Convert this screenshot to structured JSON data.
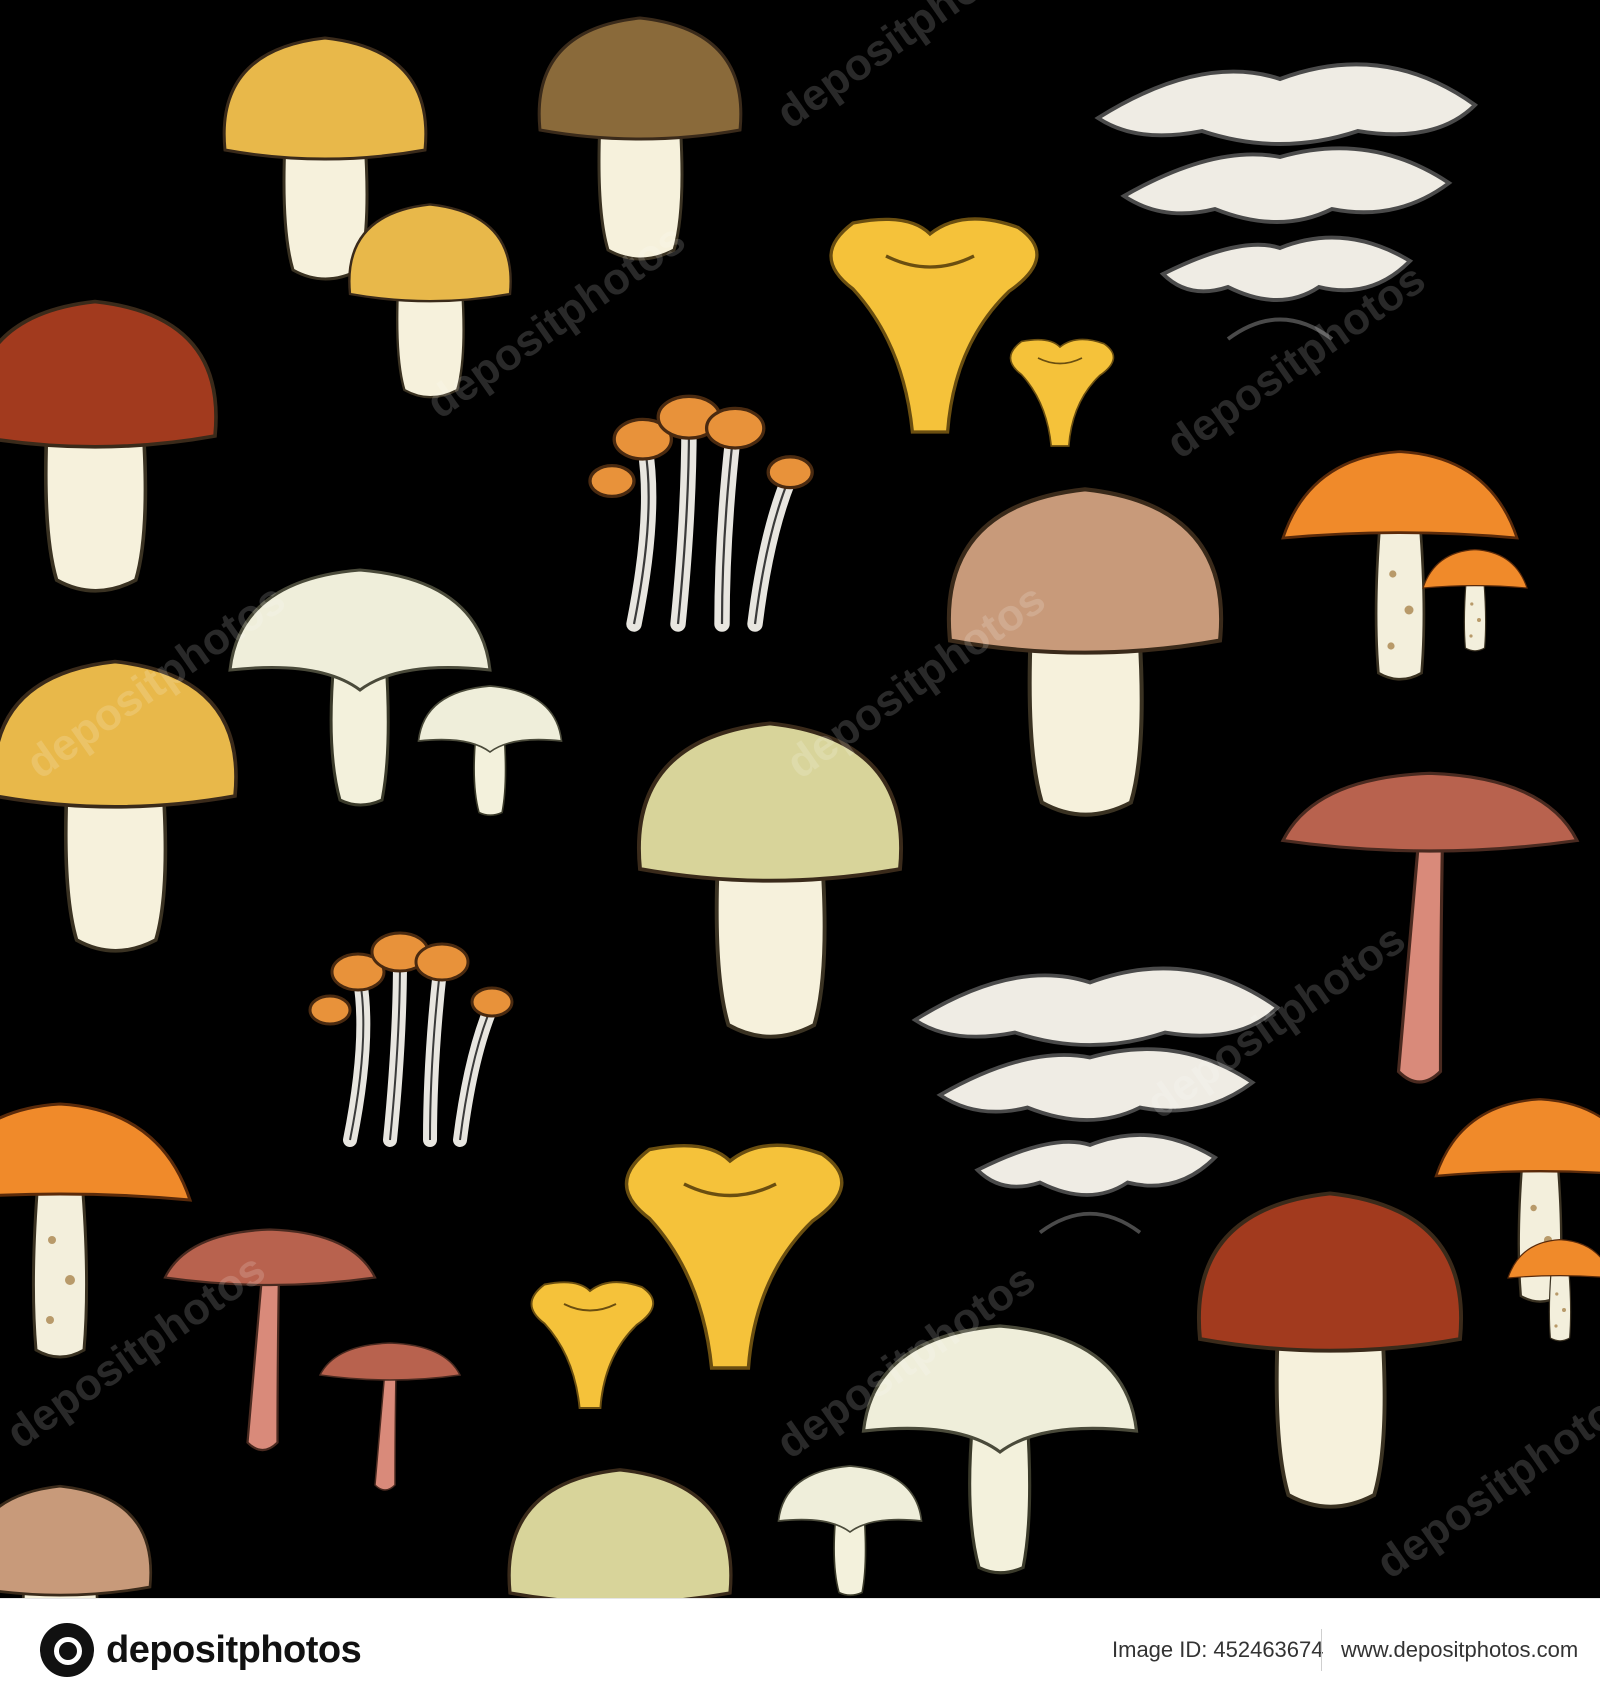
{
  "artwork": {
    "background_color": "#000000",
    "watermark_text": "depositphotos",
    "mushroom_groups": [
      "porcini",
      "butter-mushroom",
      "chanterelle",
      "oyster-mushroom",
      "honey-fungus",
      "orange-birch-bolete",
      "milk-cap",
      "russula",
      "parasol",
      "pink-bolete"
    ]
  },
  "footer": {
    "logo_text": "depositphotos",
    "image_id_label": "Image ID:",
    "image_id_value": "452463674",
    "site_url": "www.depositphotos.com"
  }
}
